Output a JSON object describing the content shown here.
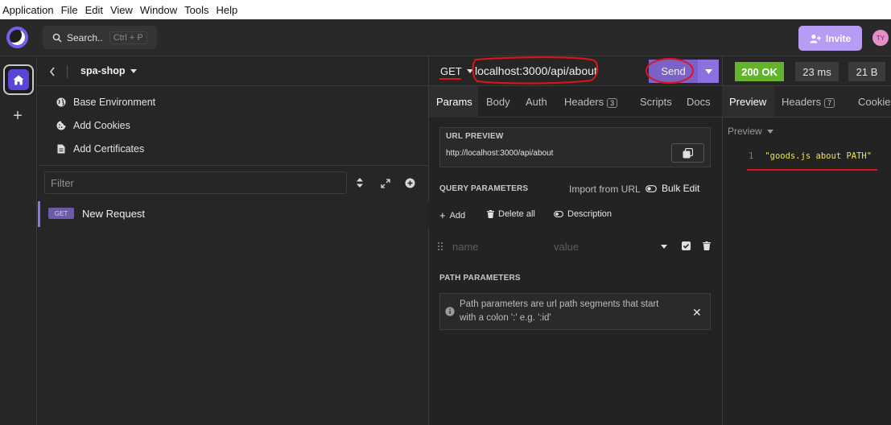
{
  "menubar": {
    "items": [
      "Application",
      "File",
      "Edit",
      "View",
      "Window",
      "Tools",
      "Help"
    ]
  },
  "header": {
    "search_label": "Search..",
    "search_shortcut": "Ctrl + P",
    "invite_label": "Invite",
    "avatar_initials": "TY",
    "accent_color": "#7a5cf0"
  },
  "sidebar": {
    "project_name": "spa-shop",
    "items": [
      {
        "label": "Base Environment",
        "icon": "globe-icon"
      },
      {
        "label": "Add Cookies",
        "icon": "cookie-icon"
      },
      {
        "label": "Add Certificates",
        "icon": "file-icon"
      }
    ],
    "filter_placeholder": "Filter",
    "requests": [
      {
        "method": "GET",
        "name": "New Request"
      }
    ]
  },
  "request": {
    "method": "GET",
    "url": "localhost:3000/api/about",
    "send_label": "Send",
    "tabs": [
      {
        "label": "Params",
        "badge": ""
      },
      {
        "label": "Body",
        "badge": ""
      },
      {
        "label": "Auth",
        "badge": ""
      },
      {
        "label": "Headers",
        "badge": "3"
      },
      {
        "label": "Scripts",
        "badge": ""
      },
      {
        "label": "Docs",
        "badge": ""
      }
    ],
    "url_preview_label": "URL PREVIEW",
    "url_preview_value": "http://localhost:3000/api/about",
    "query_params_label": "QUERY PARAMETERS",
    "import_from_url_label": "Import from URL",
    "bulk_edit_label": "Bulk Edit",
    "add_label": "Add",
    "delete_all_label": "Delete all",
    "description_label": "Description",
    "param_name_placeholder": "name",
    "param_value_placeholder": "value",
    "path_params_label": "PATH PARAMETERS",
    "path_params_info_line1": "Path parameters are url path segments that start",
    "path_params_info_line2": "with a colon ':' e.g. ':id'"
  },
  "response": {
    "status": "200 OK",
    "time": "23 ms",
    "size": "21 B",
    "tabs": [
      {
        "label": "Preview",
        "badge": ""
      },
      {
        "label": "Headers",
        "badge": "7"
      },
      {
        "label": "Cookie",
        "badge": ""
      }
    ],
    "preview_mode_label": "Preview",
    "line_number": "1",
    "body": "\"goods.js about PATH\"",
    "status_color": "#64b32d",
    "body_color": "#f2e34a"
  }
}
